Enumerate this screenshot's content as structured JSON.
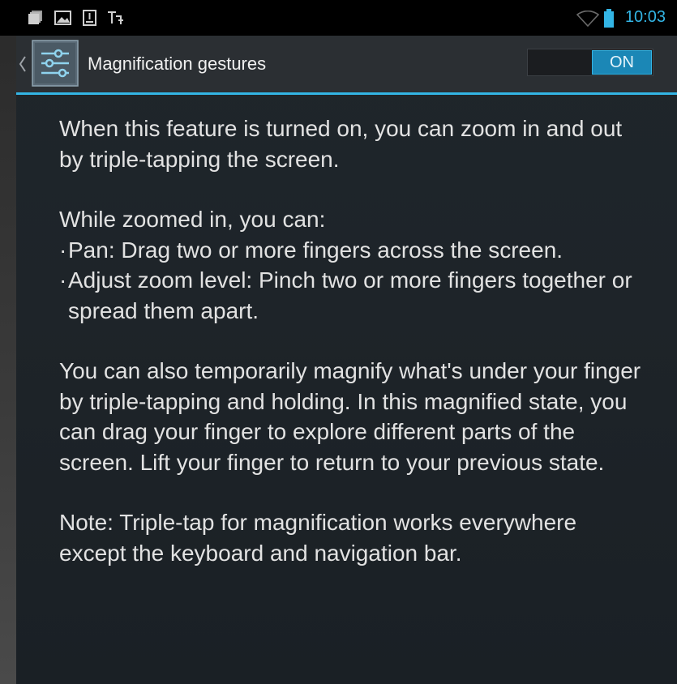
{
  "status_bar": {
    "time": "10:03",
    "icons": [
      "gallery-stack-icon",
      "picture-icon",
      "download-icon",
      "usb-debug-icon",
      "wifi-icon",
      "battery-icon"
    ],
    "accent_color": "#33b5e5"
  },
  "action_bar": {
    "title": "Magnification gestures",
    "toggle_label": "ON",
    "toggle_state": "on",
    "icon": "accessibility-settings-icon"
  },
  "content": {
    "intro": "When this feature is turned on, you can zoom in and out by triple-tapping the screen.",
    "zoomed_heading": "While zoomed in, you can:",
    "bullets": [
      "Pan: Drag two or more fingers across the screen.",
      "Adjust zoom level: Pinch two or more fingers together or spread them apart."
    ],
    "temporary": "You can also temporarily magnify what's under your finger by triple-tapping and holding. In this magnified state, you can drag your finger to explore different parts of the screen. Lift your finger to return to your previous state.",
    "note": "Note: Triple-tap for magnification works everywhere except the keyboard and navigation bar."
  }
}
